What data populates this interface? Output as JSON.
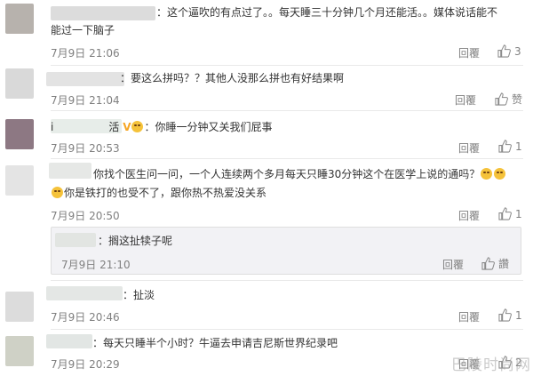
{
  "comments": [
    {
      "text_line1": "：这个逼吹的有点过了。。每天睡三十分钟几个月还能活。。媒体说话能不",
      "text_line2": "能过一下脑子",
      "time": "7月9日 21:06",
      "reply_label": "回覆",
      "like_count": "3"
    },
    {
      "text": "：要这么拼吗？？其他人没那么拼也有好结果啊",
      "time": "7月9日 21:04",
      "reply_label": "回覆",
      "like_label": "赞"
    },
    {
      "name_suffix": "i",
      "name_suffix2": "活",
      "badge": "V",
      "text": "：你睡一分钟又关我们屁事",
      "time": "7月9日 20:53",
      "reply_label": "回覆",
      "like_count": "1"
    },
    {
      "text_line1": "你找个医生问一问，一个人连续两个多月每天只睡30分钟这个在医学上说的通吗？",
      "text_line2": "你是铁打的也受不了，跟你热不热爱没关系",
      "time": "7月9日 20:50",
      "reply_label": "回覆",
      "like_count": "1"
    },
    {
      "text": "：搁这扯犊子呢",
      "time": "7月9日 21:10",
      "reply_label": "回覆",
      "like_label": "讚"
    },
    {
      "text": "：扯淡",
      "time": "7月9日 20:46",
      "reply_label": "回覆",
      "like_count": "1"
    },
    {
      "text": "：每天只睡半个小时？牛逼去申请吉尼斯世界纪录吧",
      "time": "7月9日 20:29",
      "reply_label": "回覆",
      "like_count": "2"
    }
  ],
  "watermark": "巴陵时尚网"
}
